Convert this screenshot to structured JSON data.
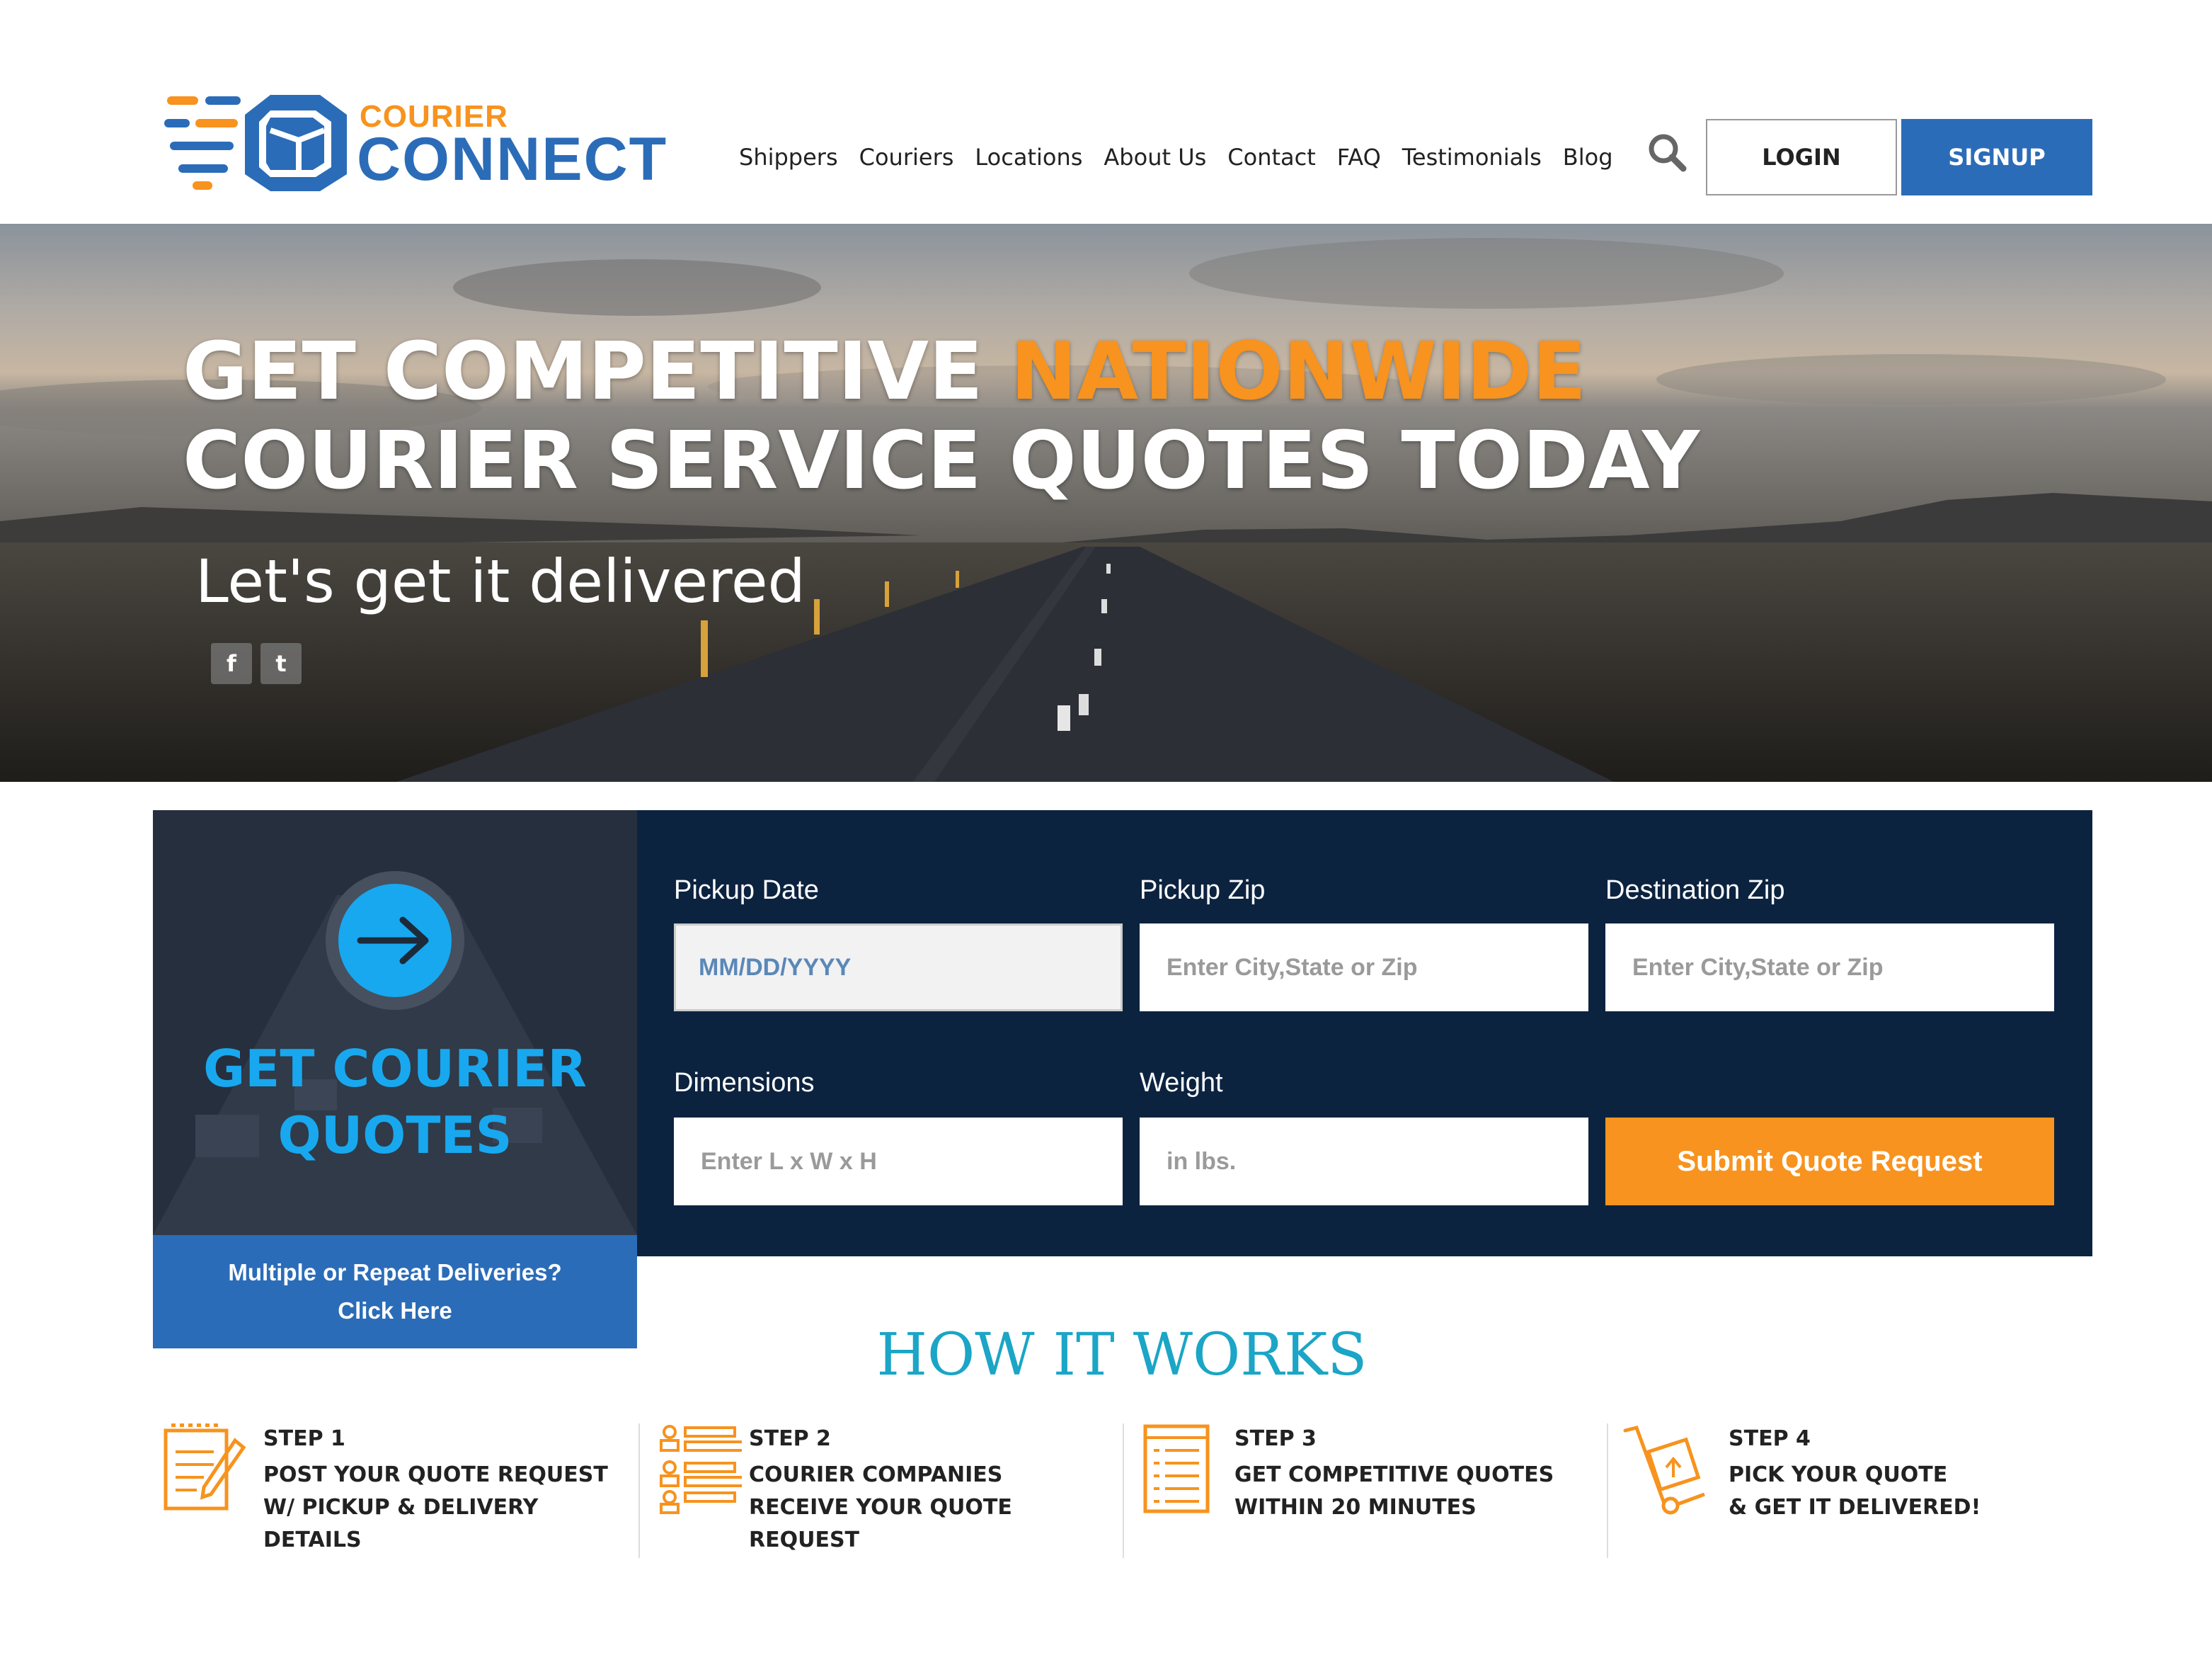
{
  "brand": {
    "logo_top": "COURIER",
    "logo_bottom": "CONNECT"
  },
  "nav": {
    "items": [
      "Shippers",
      "Couriers",
      "Locations",
      "About Us",
      "Contact",
      "FAQ",
      "Testimonials",
      "Blog"
    ],
    "login": "LOGIN",
    "signup": "SIGNUP"
  },
  "hero": {
    "line1_part1": "GET COMPETITIVE ",
    "line1_accent": "NATIONWIDE",
    "line2": "COURIER SERVICE QUOTES TODAY",
    "subtitle": "Let's get it delivered",
    "social": [
      "f",
      "t"
    ]
  },
  "quote": {
    "title_line1": "GET COURIER",
    "title_line2": "QUOTES",
    "multi_line1": "Multiple or Repeat Deliveries?",
    "multi_line2": "Click Here",
    "pickup_date_label": "Pickup Date",
    "pickup_date_value": "MM/DD/YYYY",
    "pickup_zip_label": "Pickup Zip",
    "pickup_zip_placeholder": "Enter City,State or Zip",
    "dest_zip_label": "Destination Zip",
    "dest_zip_placeholder": "Enter City,State or Zip",
    "dimensions_label": "Dimensions",
    "dimensions_placeholder": "Enter L x W x H",
    "weight_label": "Weight",
    "weight_placeholder": "in lbs.",
    "submit": "Submit Quote Request"
  },
  "how": {
    "title": "HOW IT WORKS",
    "steps": [
      {
        "num": "STEP 1",
        "lines": [
          "POST YOUR QUOTE REQUEST",
          "W/ PICKUP & DELIVERY",
          "DETAILS"
        ]
      },
      {
        "num": "STEP 2",
        "lines": [
          "COURIER COMPANIES",
          "RECEIVE YOUR QUOTE",
          "REQUEST"
        ]
      },
      {
        "num": "STEP 3",
        "lines": [
          "GET COMPETITIVE QUOTES",
          "WITHIN 20 MINUTES"
        ]
      },
      {
        "num": "STEP 4",
        "lines": [
          "PICK YOUR QUOTE",
          "& GET IT DELIVERED!"
        ]
      }
    ]
  },
  "colors": {
    "brand_blue": "#2b6cb8",
    "brand_orange": "#f7931e",
    "navy": "#0c2340",
    "cyan": "#18a8ef",
    "teal_heading": "#1ba5c6"
  }
}
